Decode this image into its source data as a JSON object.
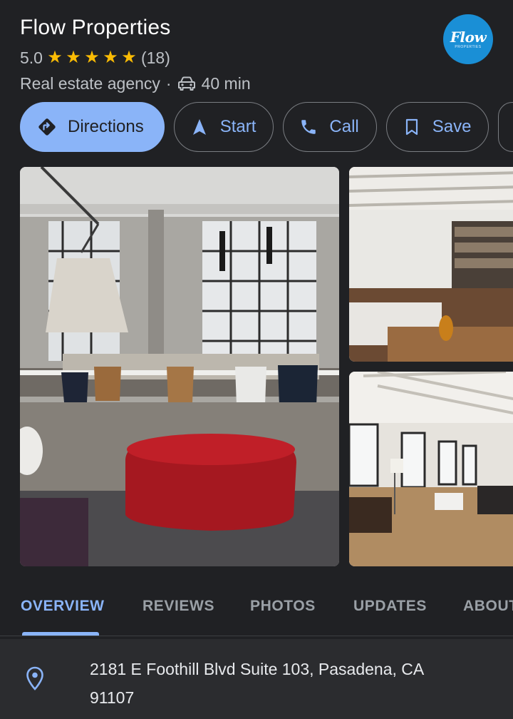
{
  "place": {
    "name": "Flow Properties",
    "rating": "5.0",
    "stars": [
      "★",
      "★",
      "★",
      "★",
      "★"
    ],
    "review_count": "(18)",
    "category": "Real estate agency",
    "separator": "·",
    "travel_time": "40 min",
    "logo_text": "Flow",
    "logo_subtext": "PROPERTIES"
  },
  "actions": {
    "directions": "Directions",
    "start": "Start",
    "call": "Call",
    "save": "Save"
  },
  "tabs": {
    "overview": "OVERVIEW",
    "reviews": "REVIEWS",
    "photos": "PHOTOS",
    "updates": "UPDATES",
    "about": "ABOUT"
  },
  "address": {
    "line1": "2181 E Foothill Blvd Suite 103, Pasadena, CA",
    "line2": "91107"
  },
  "colors": {
    "background": "#202124",
    "accent": "#8ab4f8",
    "star": "#fbbc04",
    "logo": "#1a8fd6"
  }
}
